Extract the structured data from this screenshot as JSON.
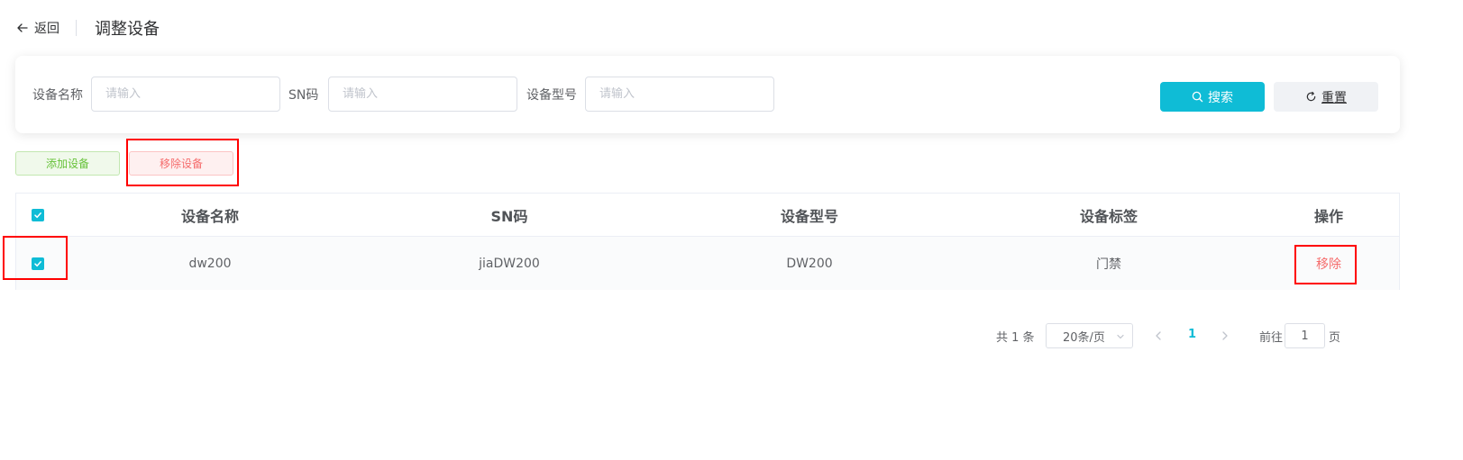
{
  "header": {
    "back_label": "返回",
    "title": "调整设备"
  },
  "search": {
    "fields": [
      {
        "label": "设备名称",
        "placeholder": "请输入"
      },
      {
        "label": "SN码",
        "placeholder": "请输入"
      },
      {
        "label": "设备型号",
        "placeholder": "请输入"
      }
    ],
    "search_label": "搜索",
    "reset_label": "重置"
  },
  "actions": {
    "add_label": "添加设备",
    "remove_label": "移除设备"
  },
  "table": {
    "columns": [
      "设备名称",
      "SN码",
      "设备型号",
      "设备标签",
      "操作"
    ],
    "rows": [
      {
        "name": "dw200",
        "sn": "jiaDW200",
        "model": "DW200",
        "tag": "门禁",
        "action": "移除",
        "checked": true
      }
    ],
    "header_checked": true
  },
  "pagination": {
    "total_text": "共 1 条",
    "page_size": "20条/页",
    "current_page": "1",
    "goto_label": "前往",
    "goto_value": "1",
    "page_suffix": "页"
  },
  "colors": {
    "accent": "#0fbcd6",
    "success": "#67c23a",
    "danger": "#f56c6c",
    "annotation": "#ff0000"
  }
}
